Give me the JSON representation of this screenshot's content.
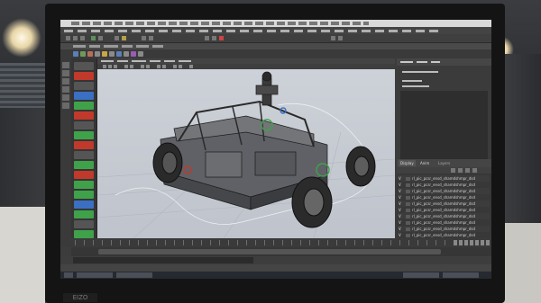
{
  "layers_panel": {
    "tabs": [
      "Display",
      "Anim"
    ],
    "active_tab": "Display",
    "title": "Layers",
    "rows": [
      {
        "visible": "V",
        "name": "rl_pic_pcsr_ensd_shamdshmpr_dsd"
      },
      {
        "visible": "V",
        "name": "rl_pic_pcsr_ensd_shamdshmpr_dsd"
      },
      {
        "visible": "V",
        "name": "rl_pic_pcsr_ensd_shamdshmpr_dsd"
      },
      {
        "visible": "V",
        "name": "rl_pic_pcsr_ensd_shamdshmpr_dsd"
      },
      {
        "visible": "V",
        "name": "rl_pic_pcsr_ensd_shamdshmpr_dsd"
      },
      {
        "visible": "V",
        "name": "rl_pic_pcsr_ensd_shamdshmpr_dsd"
      },
      {
        "visible": "V",
        "name": "rl_pic_pcsr_ensd_shamdshmpr_dsd"
      },
      {
        "visible": "V",
        "name": "rl_pic_pcsr_ensd_shamdshmpr_dsd"
      },
      {
        "visible": "V",
        "name": "rl_pic_pcsr_ensd_shamdshmpr_dsd"
      },
      {
        "visible": "V",
        "name": "rl_pic_pcsr_ensd_shamdshmpr_dsd"
      },
      {
        "visible": "V",
        "name": "rl_pic_pcsr_ensd_shamdshmpr_dsd"
      }
    ]
  },
  "colors": {
    "viewport_bg": "#c6cad2",
    "ui_dark": "#3a3a3a",
    "accent_green": "#3fa24a",
    "accent_red": "#c0392b",
    "accent_blue": "#3b6fc2"
  },
  "icons": {
    "toolbox": [
      "select-icon",
      "lasso-icon",
      "paint-icon",
      "move-icon",
      "rotate-icon",
      "scale-icon"
    ]
  }
}
